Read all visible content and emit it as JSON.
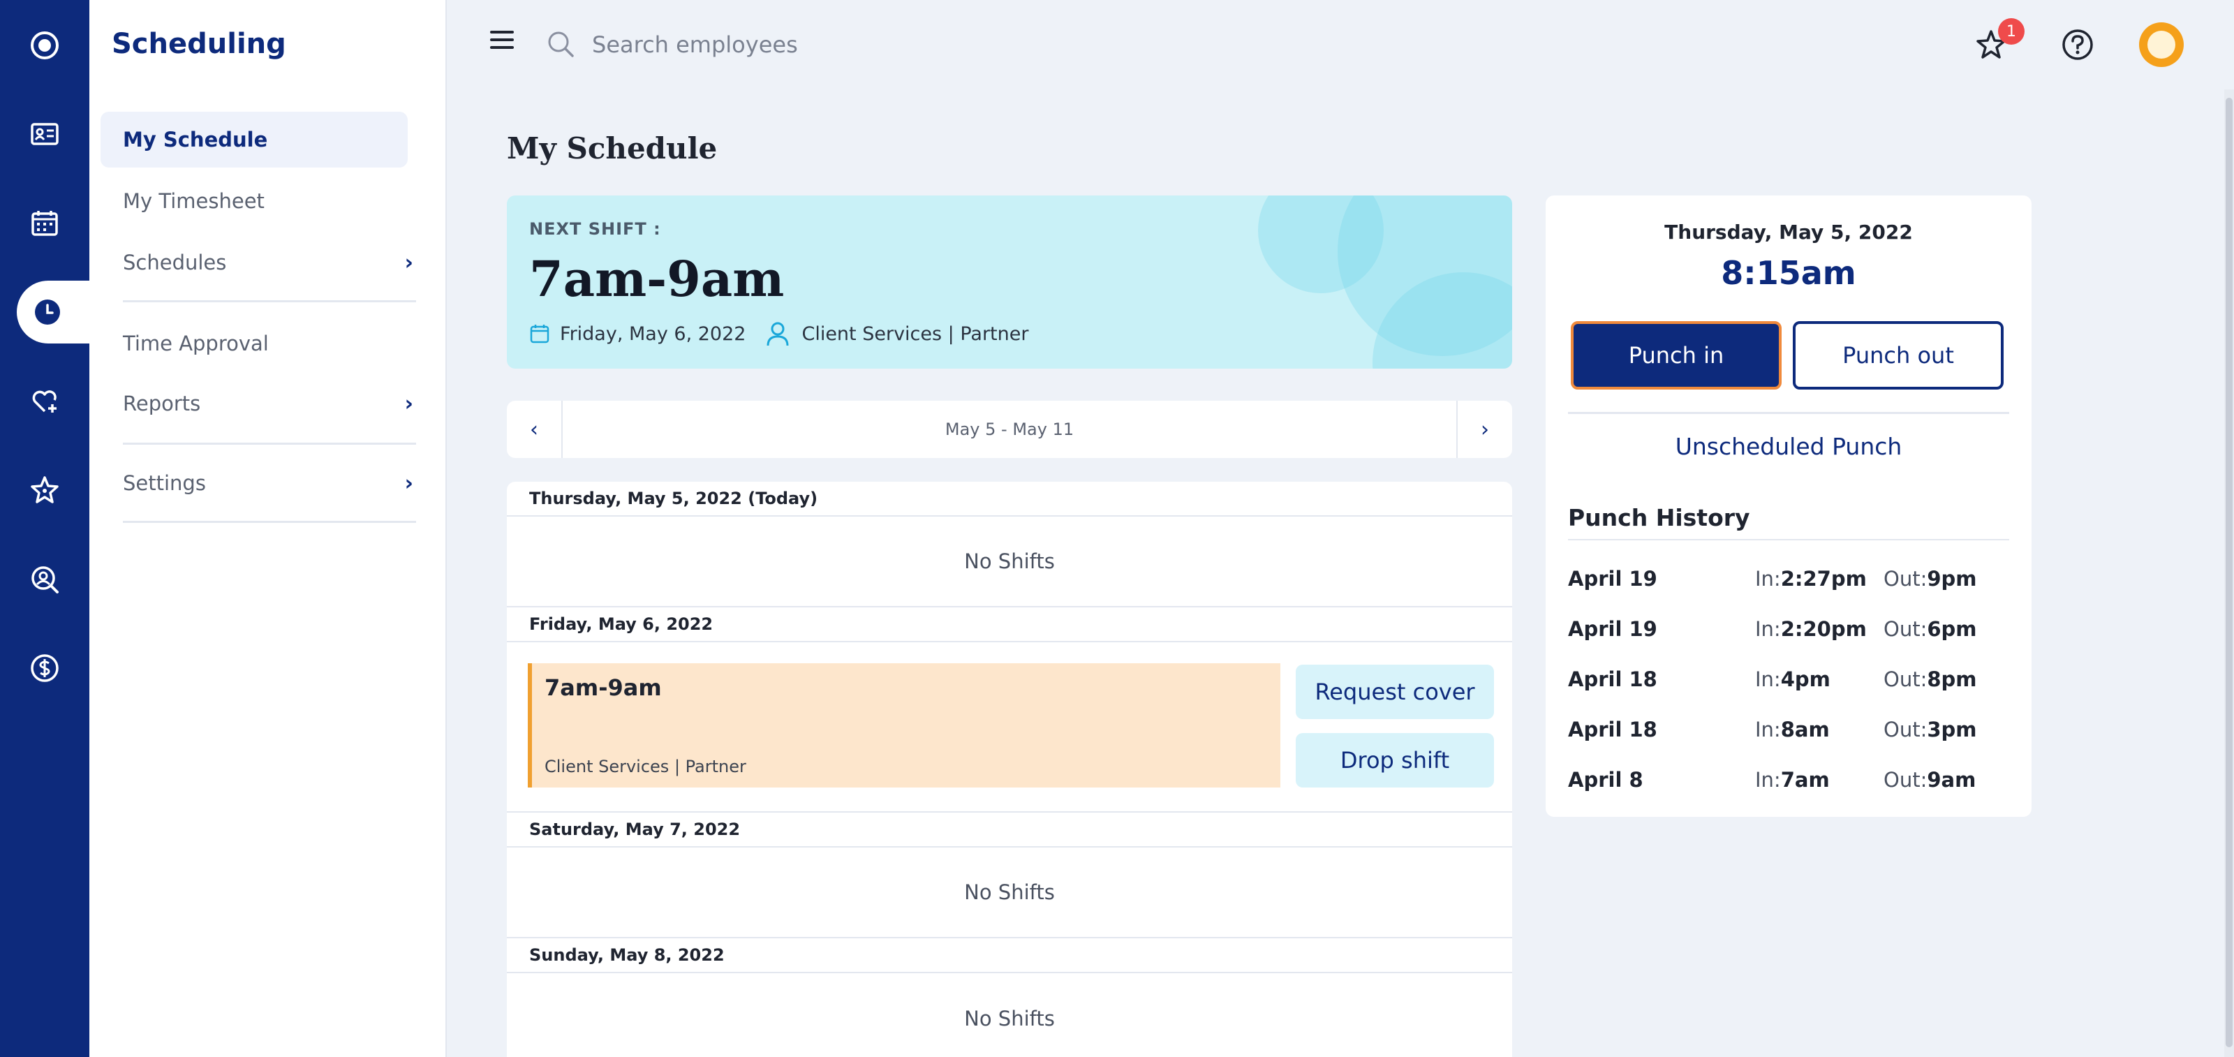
{
  "app": {
    "title": "Scheduling"
  },
  "rail": {
    "items": [
      {
        "icon": "logo-icon"
      },
      {
        "icon": "id-card-icon"
      },
      {
        "icon": "calendar-icon"
      },
      {
        "icon": "clock-icon",
        "active": true
      },
      {
        "icon": "heart-plus-icon"
      },
      {
        "icon": "star-icon"
      },
      {
        "icon": "person-search-icon"
      },
      {
        "icon": "dollar-icon"
      }
    ]
  },
  "sidebar": {
    "items": [
      {
        "label": "My Schedule",
        "active": true
      },
      {
        "label": "My Timesheet"
      },
      {
        "label": "Schedules",
        "has_submenu": true
      },
      {
        "label": "Time Approval"
      },
      {
        "label": "Reports",
        "has_submenu": true
      },
      {
        "label": "Settings",
        "has_submenu": true
      }
    ]
  },
  "topbar": {
    "search_placeholder": "Search employees",
    "notification_count": "1"
  },
  "page": {
    "title": "My Schedule"
  },
  "next_shift": {
    "label": "NEXT SHIFT :",
    "time": "7am-9am",
    "date": "Friday, May 6, 2022",
    "department": "Client Services | Partner"
  },
  "week_nav": {
    "range": "May 5 - May 11",
    "prev": "‹",
    "next": "›"
  },
  "schedule": {
    "days": [
      {
        "header": "Thursday, May 5, 2022 (Today)",
        "empty_text": "No Shifts"
      },
      {
        "header": "Friday, May 6, 2022",
        "shift": {
          "time": "7am-9am",
          "department": "Client Services | Partner"
        },
        "actions": [
          "Request cover",
          "Drop shift"
        ]
      },
      {
        "header": "Saturday, May 7, 2022",
        "empty_text": "No Shifts"
      },
      {
        "header": "Sunday, May 8, 2022",
        "empty_text": "No Shifts"
      }
    ]
  },
  "punch": {
    "date": "Thursday, May 5, 2022",
    "time": "8:15am",
    "punch_in_label": "Punch in",
    "punch_out_label": "Punch out",
    "unscheduled_label": "Unscheduled Punch",
    "history_title": "Punch History",
    "in_label": "In:",
    "out_label": "Out:",
    "history": [
      {
        "date": "April 19",
        "in": "2:27pm",
        "out": "9pm"
      },
      {
        "date": "April 19",
        "in": "2:20pm",
        "out": "6pm"
      },
      {
        "date": "April 18",
        "in": "4pm",
        "out": "8pm"
      },
      {
        "date": "April 18",
        "in": "8am",
        "out": "3pm"
      },
      {
        "date": "April 8",
        "in": "7am",
        "out": "9am"
      }
    ]
  },
  "colors": {
    "primary": "#0d2a7c",
    "next_shift_bg": "#c9f1f7",
    "shift_bg": "#fde6cc",
    "shift_accent": "#f0a030",
    "focus_ring": "#f08a3c",
    "badge": "#ef4b4b",
    "avatar": "#f5a01a"
  }
}
